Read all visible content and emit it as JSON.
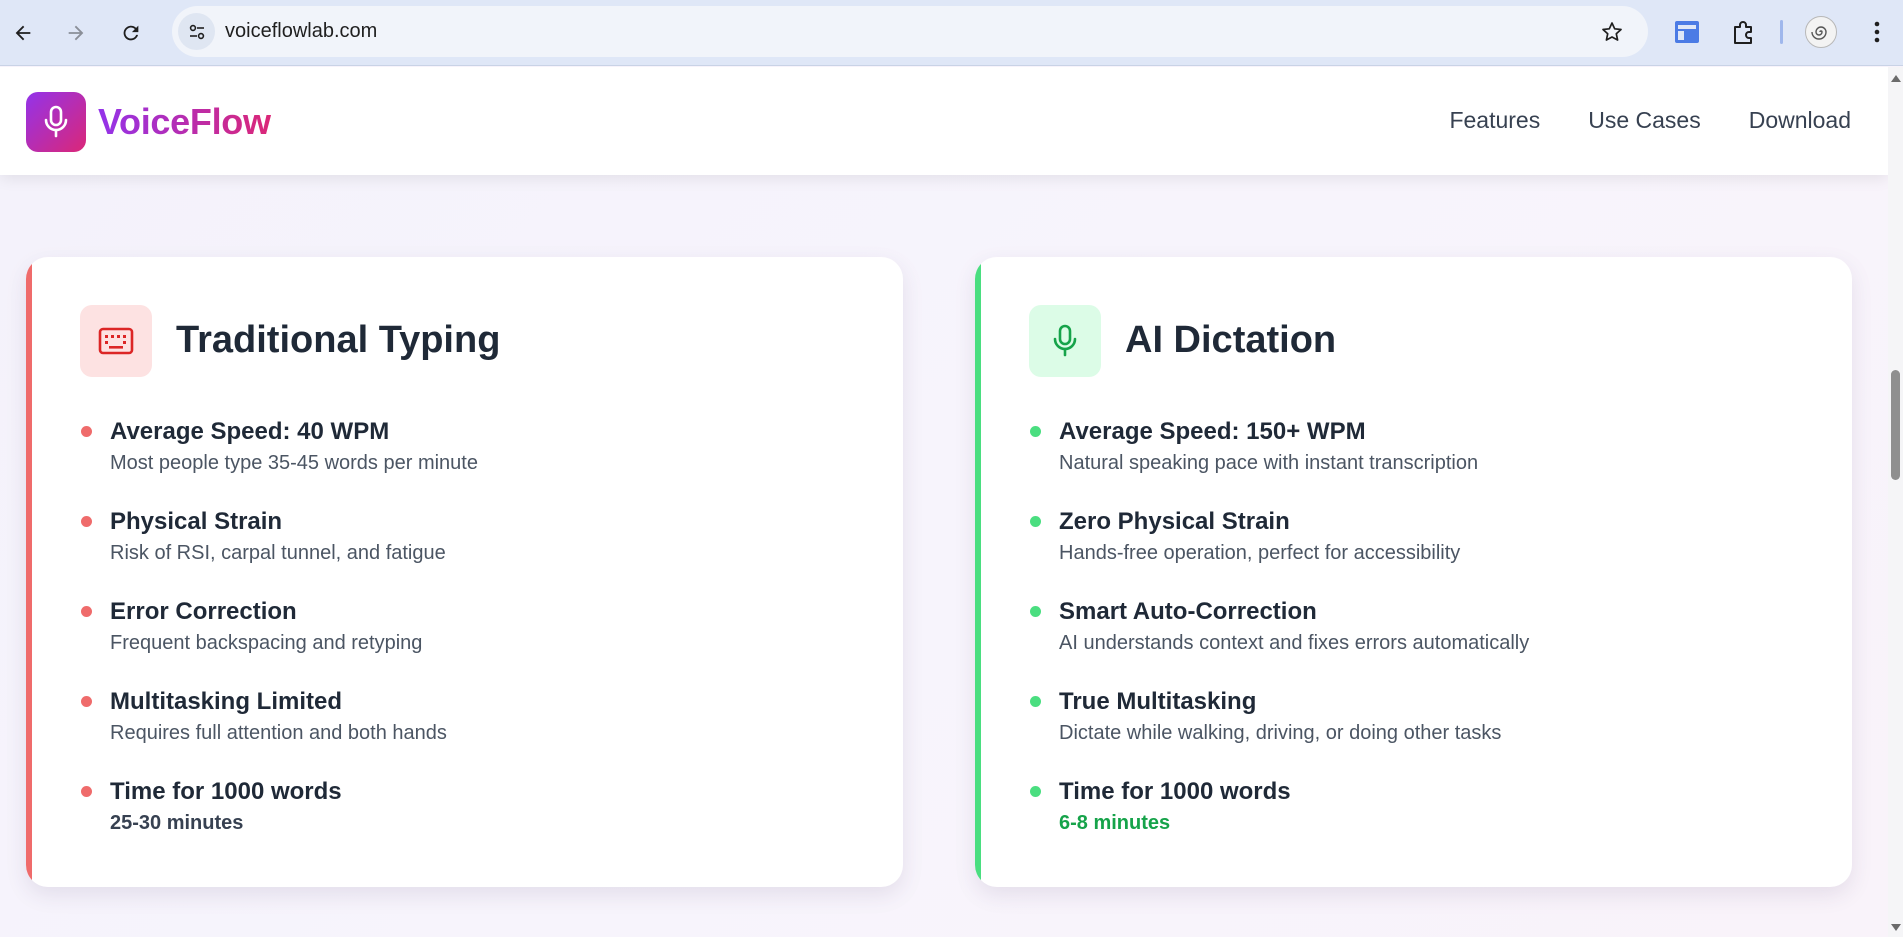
{
  "browser": {
    "url": "voiceflowlab.com"
  },
  "header": {
    "logo_text": "VoiceFlow",
    "nav": [
      "Features",
      "Use Cases",
      "Download"
    ]
  },
  "cards": [
    {
      "title": "Traditional Typing",
      "icon": "keyboard-icon",
      "accent": "#ef6b6b",
      "items": [
        {
          "title": "Average Speed: 40 WPM",
          "desc": "Most people type 35-45 words per minute"
        },
        {
          "title": "Physical Strain",
          "desc": "Risk of RSI, carpal tunnel, and fatigue"
        },
        {
          "title": "Error Correction",
          "desc": "Frequent backspacing and retyping"
        },
        {
          "title": "Multitasking Limited",
          "desc": "Requires full attention and both hands"
        },
        {
          "title": "Time for 1000 words",
          "desc": "25-30 minutes"
        }
      ]
    },
    {
      "title": "AI Dictation",
      "icon": "microphone-icon",
      "accent": "#4ade80",
      "items": [
        {
          "title": "Average Speed: 150+ WPM",
          "desc": "Natural speaking pace with instant transcription"
        },
        {
          "title": "Zero Physical Strain",
          "desc": "Hands-free operation, perfect for accessibility"
        },
        {
          "title": "Smart Auto-Correction",
          "desc": "AI understands context and fixes errors automatically"
        },
        {
          "title": "True Multitasking",
          "desc": "Dictate while walking, driving, or doing other tasks"
        },
        {
          "title": "Time for 1000 words",
          "desc": "6-8 minutes"
        }
      ]
    }
  ]
}
